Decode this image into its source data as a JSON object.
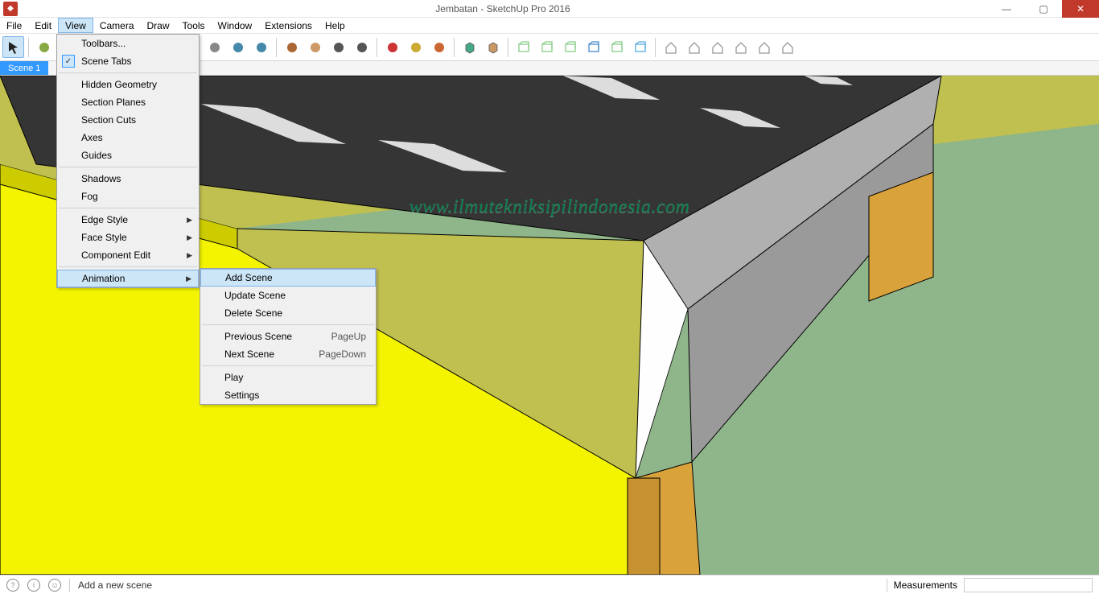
{
  "title": "Jembatan - SketchUp Pro 2016",
  "menubar": [
    "File",
    "Edit",
    "View",
    "Camera",
    "Draw",
    "Tools",
    "Window",
    "Extensions",
    "Help"
  ],
  "active_menu_index": 2,
  "scene_tab": "Scene 1",
  "watermark": "www.ilmutekniksipilindonesia.com",
  "view_menu": {
    "items": [
      {
        "label": "Toolbars...",
        "type": "item"
      },
      {
        "label": "Scene Tabs",
        "type": "item",
        "checked": true
      },
      {
        "type": "sep"
      },
      {
        "label": "Hidden Geometry",
        "type": "item"
      },
      {
        "label": "Section Planes",
        "type": "item"
      },
      {
        "label": "Section Cuts",
        "type": "item"
      },
      {
        "label": "Axes",
        "type": "item"
      },
      {
        "label": "Guides",
        "type": "item"
      },
      {
        "type": "sep"
      },
      {
        "label": "Shadows",
        "type": "item"
      },
      {
        "label": "Fog",
        "type": "item"
      },
      {
        "type": "sep"
      },
      {
        "label": "Edge Style",
        "type": "submenu"
      },
      {
        "label": "Face Style",
        "type": "submenu"
      },
      {
        "label": "Component Edit",
        "type": "submenu"
      },
      {
        "type": "sep"
      },
      {
        "label": "Animation",
        "type": "submenu",
        "highlight": true
      }
    ]
  },
  "animation_submenu": {
    "items": [
      {
        "label": "Add Scene",
        "highlight": true
      },
      {
        "label": "Update Scene"
      },
      {
        "label": "Delete Scene"
      },
      {
        "type": "sep"
      },
      {
        "label": "Previous Scene",
        "shortcut": "PageUp"
      },
      {
        "label": "Next Scene",
        "shortcut": "PageDown"
      },
      {
        "type": "sep"
      },
      {
        "label": "Play"
      },
      {
        "label": "Settings"
      }
    ]
  },
  "toolbar_groups": [
    [
      "select"
    ],
    [
      "paint-bucket",
      "orbit-red",
      "move",
      "rotate",
      "scale",
      "clipboard"
    ],
    [
      "tape",
      "protractor",
      "text",
      "dimension"
    ],
    [
      "push-pull",
      "offset",
      "zoom",
      "zoom-extents"
    ],
    [
      "warehouse-1",
      "warehouse-2",
      "warehouse-3"
    ],
    [
      "face-style-1",
      "face-style-2"
    ],
    [
      "view-iso",
      "view-top",
      "view-front",
      "view-right",
      "view-back",
      "view-left"
    ],
    [
      "house-1",
      "house-2",
      "house-3",
      "house-4",
      "house-5",
      "house-6"
    ]
  ],
  "selected_tool": "select",
  "status": {
    "hint": "Add a new scene",
    "measurements_label": "Measurements"
  }
}
